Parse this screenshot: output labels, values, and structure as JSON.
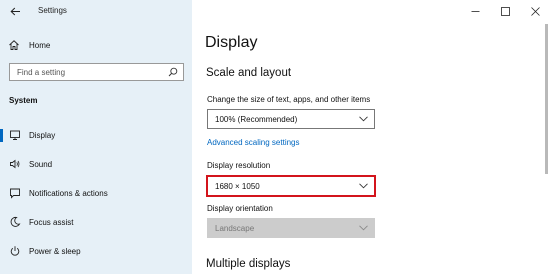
{
  "window": {
    "app_title": "Settings",
    "controls": {
      "minimize_icon": "minimize-icon",
      "maximize_icon": "maximize-icon",
      "close_icon": "close-icon"
    }
  },
  "sidebar": {
    "home_label": "Home",
    "search_placeholder": "Find a setting",
    "section_label": "System",
    "items": [
      {
        "label": "Display",
        "icon": "monitor-icon",
        "active": true
      },
      {
        "label": "Sound",
        "icon": "speaker-icon",
        "active": false
      },
      {
        "label": "Notifications & actions",
        "icon": "notification-icon",
        "active": false
      },
      {
        "label": "Focus assist",
        "icon": "moon-icon",
        "active": false
      },
      {
        "label": "Power & sleep",
        "icon": "power-icon",
        "active": false
      }
    ]
  },
  "main": {
    "page_title": "Display",
    "scale_heading": "Scale and layout",
    "scale_label": "Change the size of text, apps, and other items",
    "scale_value": "100% (Recommended)",
    "advanced_link": "Advanced scaling settings",
    "resolution_label": "Display resolution",
    "resolution_value": "1680 × 1050",
    "orientation_label": "Display orientation",
    "orientation_value": "Landscape",
    "multiple_heading": "Multiple displays"
  },
  "colors": {
    "accent": "#0067c0",
    "highlight": "#d3141c",
    "sidebar_bg": "#e6f0f7"
  }
}
